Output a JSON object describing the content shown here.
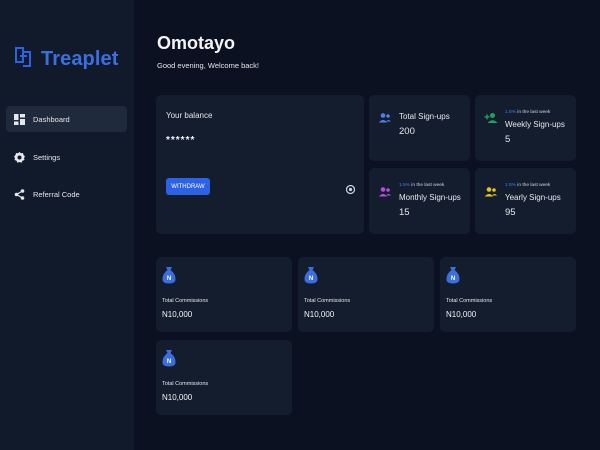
{
  "app": {
    "name": "Treaplet"
  },
  "sidebar": {
    "items": [
      {
        "label": "Dashboard",
        "icon": "dashboard-icon",
        "active": true
      },
      {
        "label": "Settings",
        "icon": "gear-icon",
        "active": false
      },
      {
        "label": "Referral Code",
        "icon": "share-icon",
        "active": false
      }
    ]
  },
  "header": {
    "name": "Omotayo",
    "greeting": "Good evening, Welcome back!"
  },
  "balance": {
    "title": "Your balance",
    "masked_value": "******",
    "withdraw_label": "WITHDRAW"
  },
  "stats": [
    {
      "label": "Total Sign-ups",
      "value": "200",
      "note_pct": "",
      "note_text": "",
      "icon": "users-icon"
    },
    {
      "label": "Weekly Sign-ups",
      "value": "5",
      "note_pct": "1.5%",
      "note_text": " in the last week",
      "icon": "user-add-icon"
    },
    {
      "label": "Monthly Sign-ups",
      "value": "15",
      "note_pct": "1.5%",
      "note_text": " in the last week",
      "icon": "users-icon"
    },
    {
      "label": "Yearly Sign-ups",
      "value": "95",
      "note_pct": "1.5%",
      "note_text": " in the last week",
      "icon": "users-icon"
    }
  ],
  "commissions": [
    {
      "label": "Total Commissions",
      "value": "N10,000",
      "bag_symbol": "N"
    },
    {
      "label": "Total Commissions",
      "value": "N10,000",
      "bag_symbol": "N"
    },
    {
      "label": "Total Commissions",
      "value": "N10,000",
      "bag_symbol": "N"
    },
    {
      "label": "Total Commissions",
      "value": "N10,000",
      "bag_symbol": "N"
    }
  ],
  "colors": {
    "accent": "#2c63e6",
    "background": "#0b1120",
    "sidebar": "#111a2b",
    "card": "#141d2e",
    "users_icon": "#4f7fe8",
    "user_add_icon": "#22a05a",
    "monthly_icon": "#b64fd8",
    "yearly_icon": "#e8c21a"
  }
}
